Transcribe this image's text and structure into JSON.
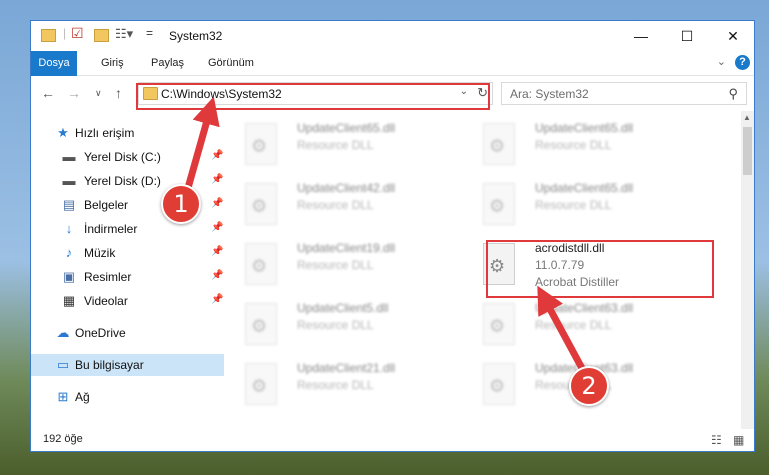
{
  "window": {
    "title": "System32",
    "controls": {
      "minimize": "—",
      "maximize": "☐",
      "close": "✕"
    }
  },
  "ribbon": {
    "tabs": [
      "Dosya",
      "Giriş",
      "Paylaş",
      "Görünüm"
    ],
    "help": "?"
  },
  "address": {
    "path": "C:\\Windows\\System32",
    "search_placeholder": "Ara: System32"
  },
  "sidebar": {
    "items": [
      {
        "label": "Hızlı erişim",
        "icon": "star-icon",
        "pinned": false
      },
      {
        "label": "Yerel Disk (C:)",
        "icon": "drive-icon",
        "pinned": true
      },
      {
        "label": "Yerel Disk (D:)",
        "icon": "drive-icon",
        "pinned": true
      },
      {
        "label": "Belgeler",
        "icon": "documents-icon",
        "pinned": true
      },
      {
        "label": "İndirmeler",
        "icon": "download-icon",
        "pinned": true
      },
      {
        "label": "Müzik",
        "icon": "music-icon",
        "pinned": true
      },
      {
        "label": "Resimler",
        "icon": "pictures-icon",
        "pinned": true
      },
      {
        "label": "Videolar",
        "icon": "video-icon",
        "pinned": true
      },
      {
        "label": "OneDrive",
        "icon": "cloud-icon",
        "pinned": false
      },
      {
        "label": "Bu bilgisayar",
        "icon": "computer-icon",
        "pinned": false
      },
      {
        "label": "Ağ",
        "icon": "network-icon",
        "pinned": false
      }
    ]
  },
  "files": {
    "left": [
      {
        "name": "UpdateClient65.dll",
        "type": "Resource DLL"
      },
      {
        "name": "UpdateClient42.dll",
        "type": "Resource DLL"
      },
      {
        "name": "UpdateClient19.dll",
        "type": "Resource DLL"
      },
      {
        "name": "UpdateClient5.dll",
        "type": "Resource DLL"
      },
      {
        "name": "UpdateClient21.dll",
        "type": "Resource DLL"
      }
    ],
    "right": [
      {
        "name": "UpdateClient65.dll",
        "type": "Resource DLL"
      },
      {
        "name": "UpdateClient65.dll",
        "type": "Resource DLL"
      },
      {
        "name": "UpdateClient63.dll",
        "type": "Resource DLL"
      },
      {
        "name": "UpdateClient63.dll",
        "type": "Resource DLL"
      }
    ],
    "highlighted": {
      "name": "acrodistdll.dll",
      "version": "11.0.7.79",
      "company": "Acrobat Distiller"
    }
  },
  "status": {
    "item_count": "192 öğe"
  },
  "callouts": {
    "step1": "1",
    "step2": "2",
    "color": "#e0393b"
  }
}
